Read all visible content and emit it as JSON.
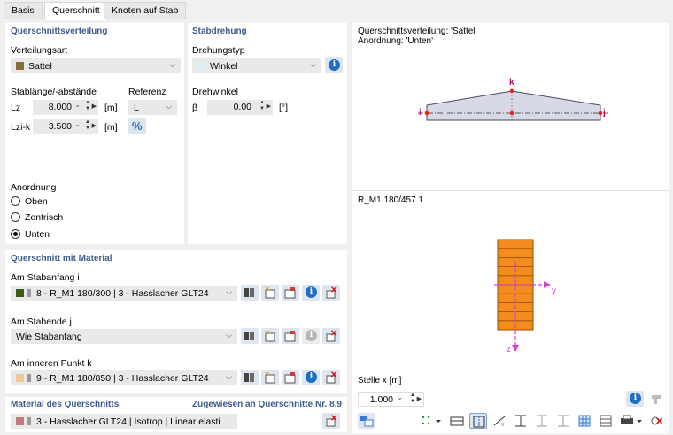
{
  "tabs": [
    "Basis",
    "Querschnitt",
    "Knoten auf Stab"
  ],
  "verteilung": {
    "section_title": "Querschnittsverteilung",
    "type_label": "Verteilungsart",
    "type_value": "Sattel",
    "type_color": "#8b6a3a",
    "length_label": "Stablänge/-abstände",
    "ref_label": "Referenz",
    "lz_label": "Lz",
    "lz_value": "8.000",
    "lz_unit": "[m]",
    "lz_ref": "L",
    "lzik_label": "Lzi-k",
    "lzik_value": "3.500",
    "lzik_unit": "[m]",
    "percent_symbol": "%",
    "anordnung_label": "Anordnung",
    "options": [
      "Oben",
      "Zentrisch",
      "Unten"
    ],
    "selected": "Unten"
  },
  "drehung": {
    "section_title": "Stabdrehung",
    "type_label": "Drehungstyp",
    "type_value": "Winkel",
    "type_color": "#d9f1f7",
    "angle_label": "Drehwinkel",
    "beta_label": "β",
    "beta_value": "0.00",
    "beta_unit": "[°]"
  },
  "material_section": {
    "title": "Querschnitt mit Material",
    "rows": [
      {
        "label": "Am Stabanfang i",
        "value": "8 - R_M1 180/300 | 3 - Hasslacher GLT24",
        "color": "#3a5a1a",
        "info_enabled": true
      },
      {
        "label": "Am Stabende j",
        "value": "Wie Stabanfang",
        "color": "",
        "info_enabled": false
      },
      {
        "label": "Am inneren Punkt k",
        "value": "9 - R_M1 180/850 | 3 - Hasslacher GLT24",
        "color": "#f0c79a",
        "info_enabled": true
      }
    ]
  },
  "material": {
    "title": "Material des Querschnitts",
    "assigned": "Zugewiesen an Querschnitte Nr. 8,9",
    "value": "3 - Hasslacher GLT24 | Isotrop | Linear elasti",
    "color": "#c47a78"
  },
  "preview_top": {
    "line1": "Querschnittsverteilung: 'Sattel'",
    "line2": "Anordnung: 'Unten'",
    "pt_i": "i",
    "pt_j": "j",
    "pt_k": "k"
  },
  "preview_bottom": {
    "title": "R_M1 180/457.1",
    "axis_y": "y",
    "axis_z": "z",
    "fill_color": "#f28c1e",
    "layers": 10,
    "stelle_label": "Stelle x [m]",
    "stelle_value": "1.000"
  },
  "colors": {
    "section_title": "#3d5a8a",
    "accent": "#1f6fc1",
    "axis": "#d63fd6"
  }
}
